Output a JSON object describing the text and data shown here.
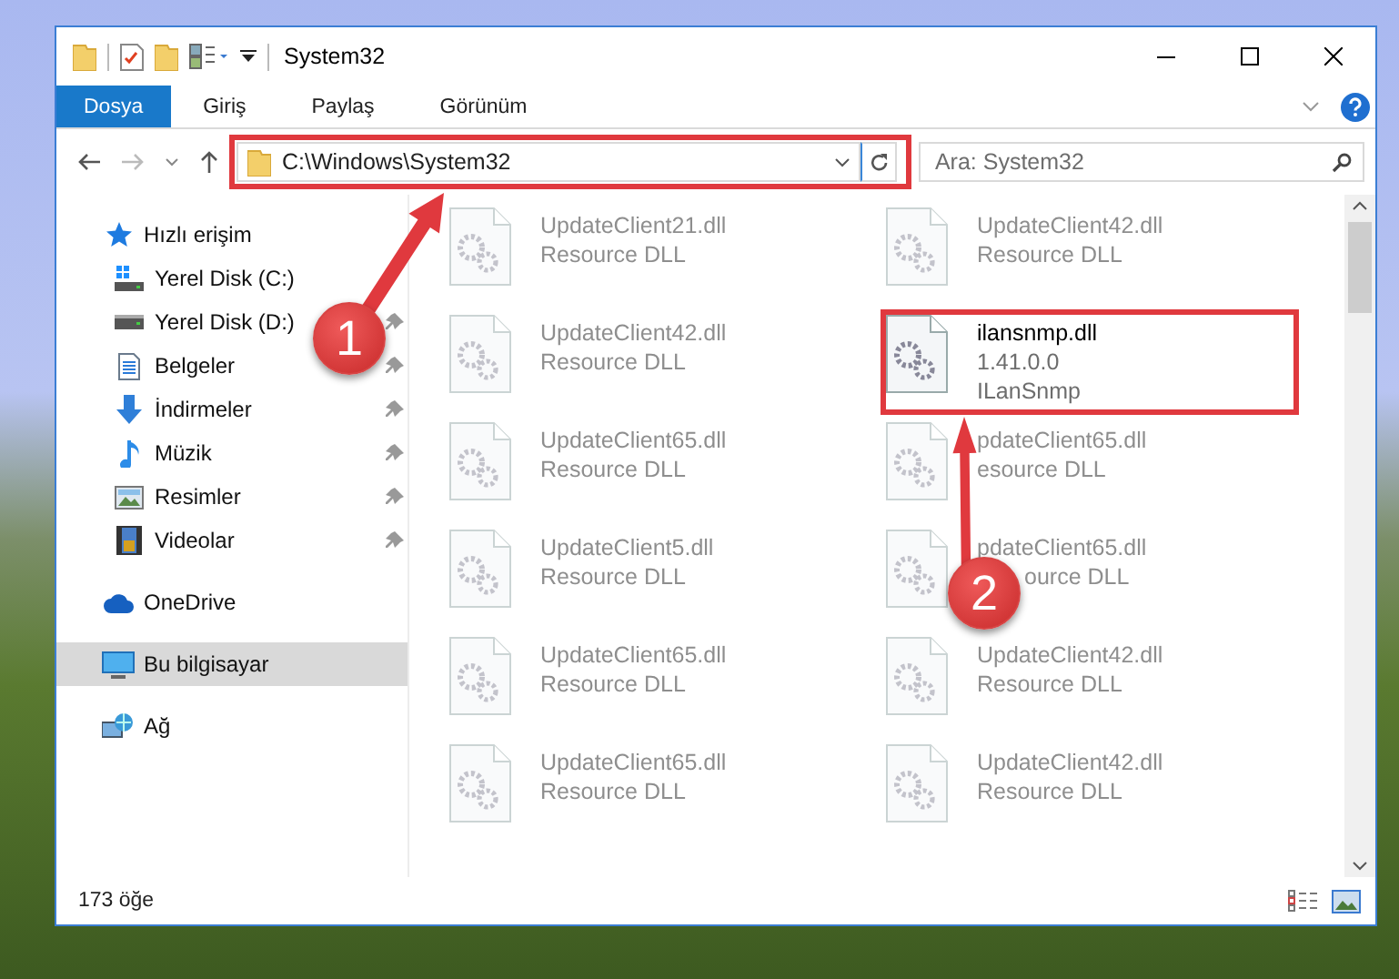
{
  "window": {
    "title": "System32"
  },
  "ribbon_tabs": [
    {
      "label": "Dosya",
      "selected": true
    },
    {
      "label": "Giriş",
      "selected": false
    },
    {
      "label": "Paylaş",
      "selected": false
    },
    {
      "label": "Görünüm",
      "selected": false
    }
  ],
  "address_bar": {
    "path": "C:\\Windows\\System32"
  },
  "search": {
    "placeholder": "Ara: System32"
  },
  "sidebar": {
    "items": [
      {
        "label": "Hızlı erişim",
        "kind": "star",
        "selected": false,
        "children": [
          {
            "label": "Yerel Disk (C:)",
            "kind": "windrive",
            "pinned": false,
            "selected": false
          },
          {
            "label": "Yerel Disk (D:)",
            "kind": "drive",
            "pinned": true,
            "selected": false
          },
          {
            "label": "Belgeler",
            "kind": "documents",
            "pinned": true,
            "selected": false
          },
          {
            "label": "İndirmeler",
            "kind": "downloads",
            "pinned": true,
            "selected": false
          },
          {
            "label": "Müzik",
            "kind": "music",
            "pinned": true,
            "selected": false
          },
          {
            "label": "Resimler",
            "kind": "pictures",
            "pinned": true,
            "selected": false
          },
          {
            "label": "Videolar",
            "kind": "videos",
            "pinned": true,
            "selected": false
          }
        ]
      },
      {
        "label": "OneDrive",
        "kind": "cloud",
        "selected": false
      },
      {
        "label": "Bu bilgisayar",
        "kind": "computer",
        "selected": true
      },
      {
        "label": "Ağ",
        "kind": "network",
        "selected": false
      }
    ]
  },
  "files": [
    {
      "name": "UpdateClient21.dll",
      "details": [
        "Resource DLL"
      ],
      "blurred": true
    },
    {
      "name": "UpdateClient42.dll",
      "details": [
        "Resource DLL"
      ],
      "blurred": true
    },
    {
      "name": "UpdateClient42.dll",
      "details": [
        "Resource DLL"
      ],
      "blurred": true
    },
    {
      "name": "ilansnmp.dll",
      "details": [
        "1.41.0.0",
        "ILanSnmp"
      ],
      "blurred": false
    },
    {
      "name": "UpdateClient65.dll",
      "details": [
        "Resource DLL"
      ],
      "blurred": true
    },
    {
      "name": "pdateClient65.dll",
      "details": [
        "esource DLL"
      ],
      "blurred": true
    },
    {
      "name": "UpdateClient5.dll",
      "details": [
        "Resource DLL"
      ],
      "blurred": true
    },
    {
      "name": "pdateClient65.dll",
      "details": [
        "ource DLL"
      ],
      "blurred": true
    },
    {
      "name": "UpdateClient65.dll",
      "details": [
        "Resource DLL"
      ],
      "blurred": true
    },
    {
      "name": "UpdateClient42.dll",
      "details": [
        "Resource DLL"
      ],
      "blurred": true
    },
    {
      "name": "UpdateClient65.dll",
      "details": [
        "Resource DLL"
      ],
      "blurred": true
    },
    {
      "name": "UpdateClient42.dll",
      "details": [
        "Resource DLL"
      ],
      "blurred": true
    }
  ],
  "annotations": [
    {
      "kind": "address",
      "number": "1"
    },
    {
      "kind": "file",
      "number": "2"
    }
  ],
  "status_bar": {
    "item_count": "173 öğe"
  }
}
